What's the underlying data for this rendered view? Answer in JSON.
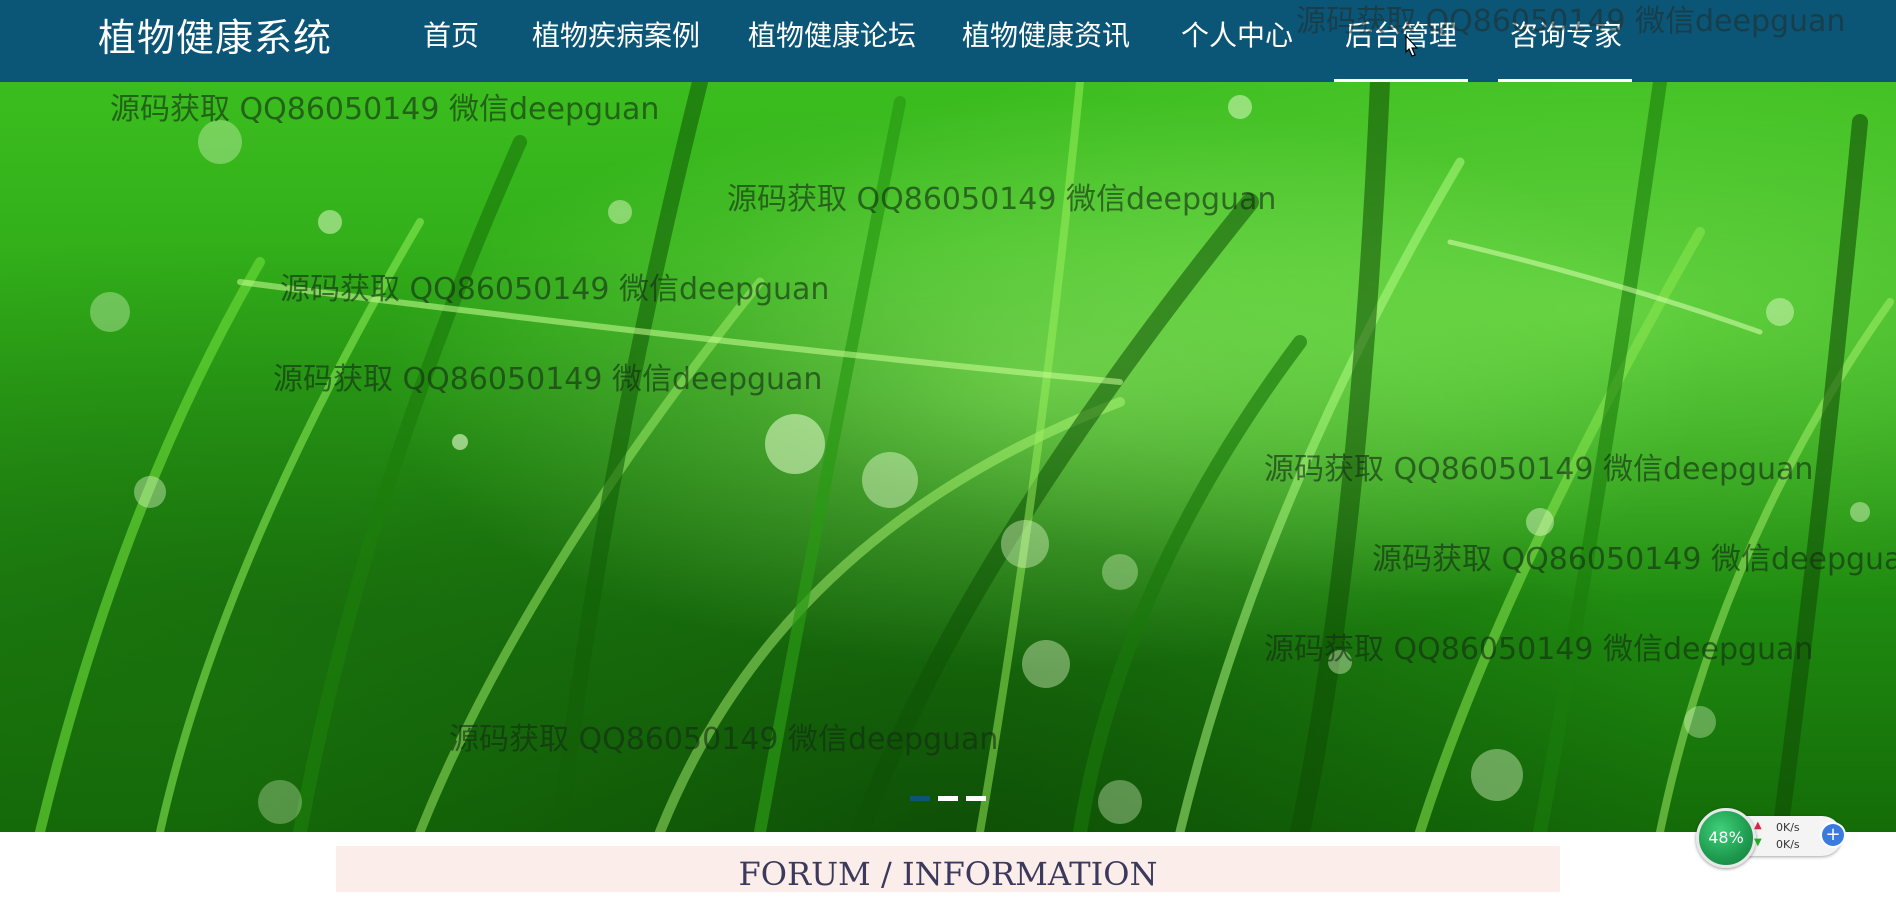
{
  "header": {
    "brand": "植物健康系统",
    "nav": [
      {
        "label": "首页"
      },
      {
        "label": "植物疾病案例"
      },
      {
        "label": "植物健康论坛"
      },
      {
        "label": "植物健康资讯"
      },
      {
        "label": "个人中心"
      },
      {
        "label": "后台管理"
      },
      {
        "label": "咨询专家"
      }
    ]
  },
  "watermark": "源码获取 QQ86050149 微信deepguan",
  "carousel": {
    "slide_count": 3,
    "active_slide": 1
  },
  "section": {
    "title": "FORUM / INFORMATION"
  },
  "net_widget": {
    "percent": "48%",
    "upload": "0K/s",
    "download": "0K/s",
    "plus": "+"
  },
  "colors": {
    "nav_bg": "#0b5577",
    "section_bg": "#fbeeea",
    "section_text": "#3c3a5c"
  }
}
